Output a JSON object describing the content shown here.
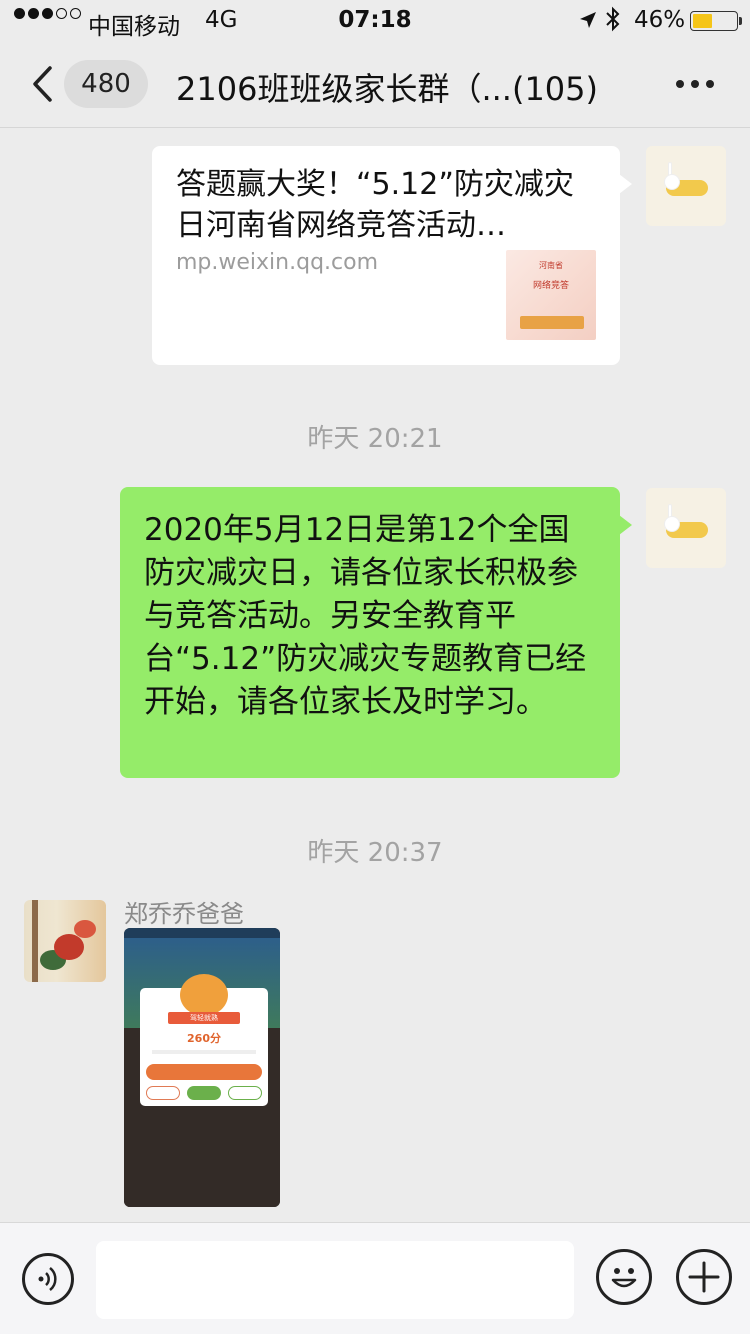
{
  "status_bar": {
    "carrier": "中国移动",
    "network": "4G",
    "time": "07:18",
    "battery_percent": "46%",
    "battery_level": 0.46,
    "signal_bars_filled": 3,
    "signal_bars_total": 5,
    "icons": [
      "location-arrow-icon",
      "bluetooth-icon",
      "battery-icon"
    ]
  },
  "nav": {
    "back_count": "480",
    "title": "2106班班级家长群（...(105)",
    "icons": [
      "back-chevron-icon",
      "more-dots-icon"
    ]
  },
  "messages": {
    "link_card": {
      "title": "答题赢大奖！“5.12”防灾减灾日河南省网络竞答活动…",
      "source": "mp.weixin.qq.com",
      "thumb_line1": "河南省",
      "thumb_line2": "网络竞答"
    },
    "timestamp1": "昨天 20:21",
    "text_message": "2020年5月12日是第12个全国防灾减灾日，请各位家长积极参与竞答活动。另安全教育平台“5.12”防灾减灾专题教育已经开始，请各位家长及时学习。",
    "timestamp2": "昨天 20:37",
    "sender_name": "郑乔乔爸爸",
    "image_message": {
      "score": "260分",
      "ribbon": "驾轻就熟"
    }
  },
  "input_bar": {
    "placeholder": "",
    "icons": [
      "voice-icon",
      "emoji-icon",
      "plus-icon"
    ]
  },
  "colors": {
    "chat_background": "#ececec",
    "my_bubble": "#95ec69",
    "incoming_bubble": "#ffffff",
    "timestamp_text": "#a3a3a3"
  }
}
